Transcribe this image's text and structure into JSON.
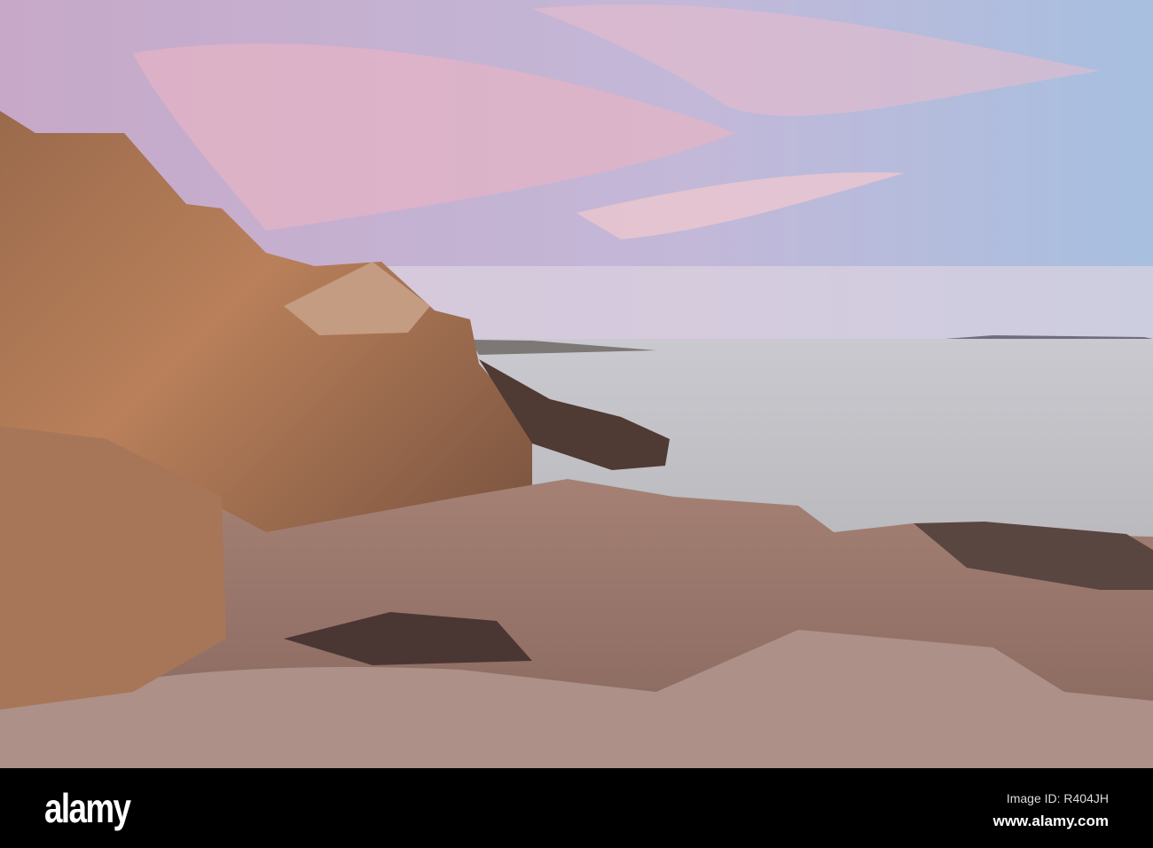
{
  "photo": {
    "subject": "rocky coastline at dusk",
    "watermark": "alamy"
  },
  "footer": {
    "logo": "alamy",
    "image_id": "Image ID: R404JH",
    "url": "www.alamy.com"
  }
}
